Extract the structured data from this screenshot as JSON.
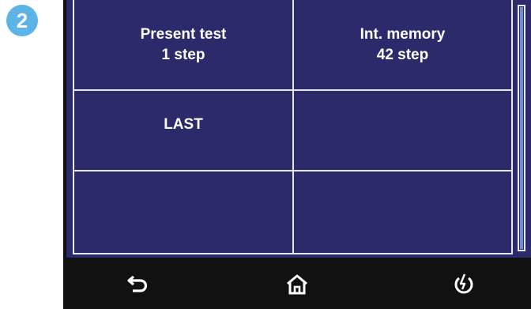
{
  "step_badge": "2",
  "cells": [
    {
      "line1": "Present test",
      "line2": "1 step"
    },
    {
      "line1": "Int. memory",
      "line2": "42 step"
    },
    {
      "line1": "LAST",
      "line2": ""
    },
    {
      "line1": "",
      "line2": ""
    },
    {
      "line1": "",
      "line2": ""
    },
    {
      "line1": "",
      "line2": ""
    }
  ],
  "nav": {
    "back_icon": "back-arrow-icon",
    "home_icon": "home-icon",
    "power_icon": "power-icon"
  },
  "colors": {
    "screen_bg": "#2b2b6b",
    "grid_line": "#e8e8f0",
    "badge": "#5bb3e6",
    "bezel": "#111111"
  }
}
